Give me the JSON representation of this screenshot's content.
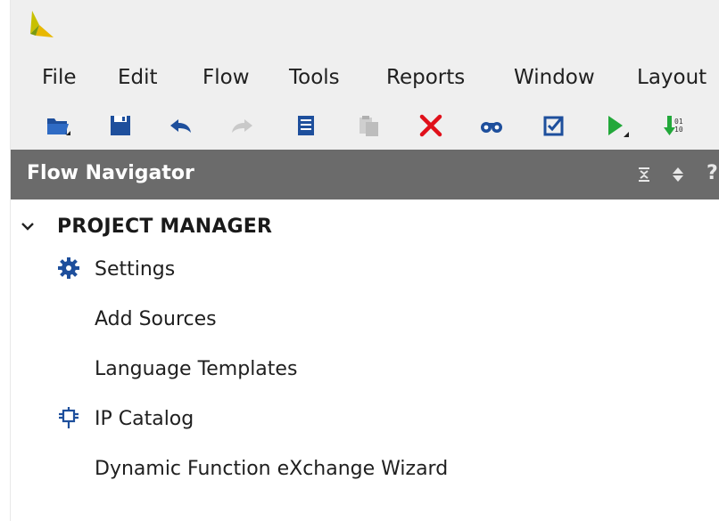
{
  "menu": {
    "file": "File",
    "edit": "Edit",
    "flow": "Flow",
    "tools": "Tools",
    "reports": "Reports",
    "window": "Window",
    "layout": "Layout"
  },
  "toolbar": {
    "buttons": [
      "open-project",
      "save-project",
      "undo",
      "redo",
      "report-view",
      "paste",
      "delete",
      "find",
      "validate",
      "run",
      "generate-bitstream"
    ]
  },
  "flow_navigator": {
    "title": "Flow Navigator"
  },
  "project_manager": {
    "label": "PROJECT MANAGER",
    "items": [
      {
        "label": "Settings",
        "icon": "gear-icon"
      },
      {
        "label": "Add Sources"
      },
      {
        "label": "Language Templates"
      },
      {
        "label": "IP Catalog",
        "icon": "ip-plug-icon"
      },
      {
        "label": "Dynamic Function eXchange Wizard"
      }
    ]
  },
  "colors": {
    "header_bg": "#6b6b6b",
    "menubar_bg": "#efefef",
    "icon_blue": "#1e4f9c",
    "delete_red": "#e0101a",
    "run_green": "#22a83a"
  }
}
